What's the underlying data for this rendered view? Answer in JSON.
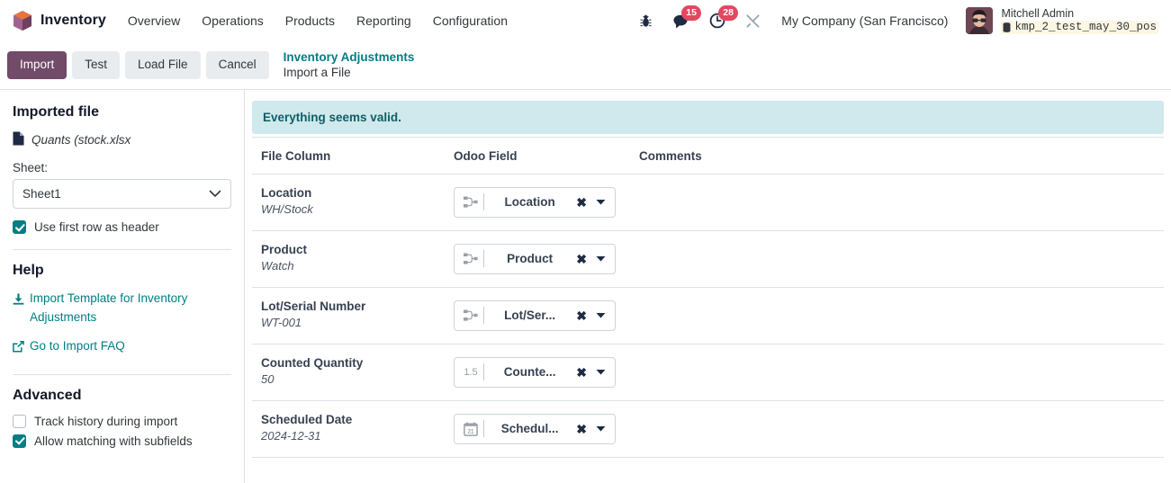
{
  "navbar": {
    "brand": "Inventory",
    "menus": [
      "Overview",
      "Operations",
      "Products",
      "Reporting",
      "Configuration"
    ],
    "icons": [
      {
        "name": "bug-icon",
        "badge": null
      },
      {
        "name": "messages-icon",
        "badge": "15"
      },
      {
        "name": "activities-clock-icon",
        "badge": "28"
      },
      {
        "name": "tools-icon",
        "badge": null
      }
    ],
    "company": "My Company (San Francisco)",
    "user_name": "Mitchell Admin",
    "database": "kmp_2_test_may_30_pos"
  },
  "control_panel": {
    "buttons": [
      {
        "label": "Import",
        "style": "primary"
      },
      {
        "label": "Test",
        "style": "secondary"
      },
      {
        "label": "Load File",
        "style": "secondary"
      },
      {
        "label": "Cancel",
        "style": "secondary"
      }
    ],
    "breadcrumb_parent": "Inventory Adjustments",
    "breadcrumb_current": "Import a File"
  },
  "sidebar": {
    "imported_file_title": "Imported file",
    "file_name": "Quants (stock.xlsx",
    "sheet_label": "Sheet:",
    "sheet_value": "Sheet1",
    "use_first_row_label": "Use first row as header",
    "use_first_row_checked": true,
    "help_title": "Help",
    "help_links": [
      {
        "icon": "download-icon",
        "label": "Import Template for Inventory Adjustments"
      },
      {
        "icon": "external-link-icon",
        "label": "Go to Import FAQ"
      }
    ],
    "advanced_title": "Advanced",
    "advanced_options": [
      {
        "label": "Track history during import",
        "checked": false
      },
      {
        "label": "Allow matching with subfields",
        "checked": true
      }
    ]
  },
  "main": {
    "alert": "Everything seems valid.",
    "columns": [
      "File Column",
      "Odoo Field",
      "Comments"
    ],
    "rows": [
      {
        "file_column": "Location",
        "sample": "WH/Stock",
        "odoo_field": "Location",
        "field_icon": "relation-icon",
        "comment": ""
      },
      {
        "file_column": "Product",
        "sample": "Watch",
        "odoo_field": "Product",
        "field_icon": "relation-icon",
        "comment": ""
      },
      {
        "file_column": "Lot/Serial Number",
        "sample": "WT-001",
        "odoo_field": "Lot/Ser...",
        "field_icon": "relation-icon",
        "comment": ""
      },
      {
        "file_column": "Counted Quantity",
        "sample": "50",
        "odoo_field": "Counte...",
        "field_icon": "number-icon",
        "comment": ""
      },
      {
        "file_column": "Scheduled Date",
        "sample": "2024-12-31",
        "odoo_field": "Schedul...",
        "field_icon": "calendar-icon",
        "comment": ""
      }
    ]
  },
  "colors": {
    "primary": "#714B67",
    "link": "#017e84",
    "badge": "#e4475f",
    "alert_bg": "#cfe9ec",
    "alert_text": "#0f5e66"
  }
}
